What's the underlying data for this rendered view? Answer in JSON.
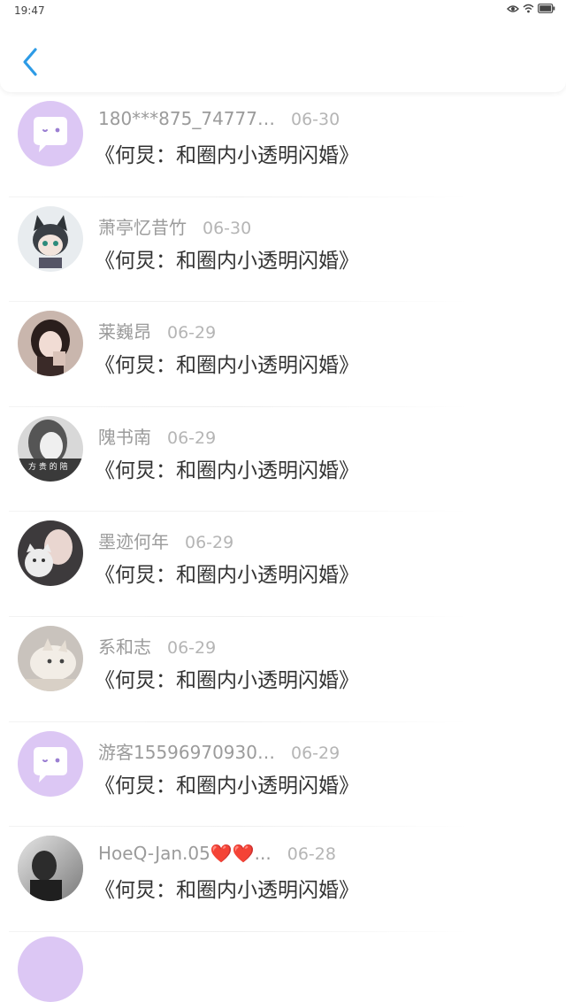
{
  "status_bar": {
    "time": "19:47",
    "icons": [
      "eye-icon",
      "wifi-icon",
      "battery-icon"
    ]
  },
  "header": {
    "back_icon": "chevron-left-icon",
    "accent_color": "#2d9be6"
  },
  "comments": [
    {
      "username": "180***875_747778...",
      "date": "06-30",
      "title": "《何炅：和圈内小透明闪婚》",
      "avatar": "default-chat-avatar"
    },
    {
      "username": "萧亭忆昔竹",
      "date": "06-30",
      "title": "《何炅：和圈内小透明闪婚》",
      "avatar": "anime-cat-avatar"
    },
    {
      "username": "莱巍昂",
      "date": "06-29",
      "title": "《何炅：和圈内小透明闪婚》",
      "avatar": "girl-photo-avatar"
    },
    {
      "username": "隗书南",
      "date": "06-29",
      "title": "《何炅：和圈内小透明闪婚》",
      "avatar": "girl-bw-photo-avatar"
    },
    {
      "username": "墨迹何年",
      "date": "06-29",
      "title": "《何炅：和圈内小透明闪婚》",
      "avatar": "girl-with-cat-avatar"
    },
    {
      "username": "系和志",
      "date": "06-29",
      "title": "《何炅：和圈内小透明闪婚》",
      "avatar": "cat-photo-avatar"
    },
    {
      "username": "游客155969709305...",
      "date": "06-29",
      "title": "《何炅：和圈内小透明闪婚》",
      "avatar": "default-chat-avatar"
    },
    {
      "username": "HoeQ-Jan.05❤️❤️...",
      "date": "06-28",
      "title": "《何炅：和圈内小透明闪婚》",
      "avatar": "dark-portrait-avatar"
    }
  ]
}
